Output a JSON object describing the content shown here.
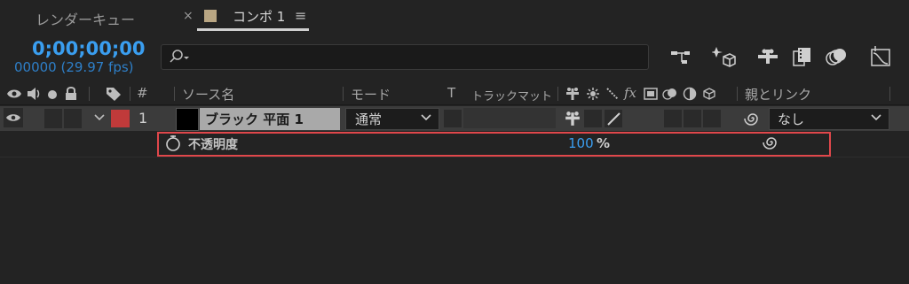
{
  "tabs": {
    "render_queue": "レンダーキュー",
    "close_symbol": "×",
    "comp": "コンポ 1",
    "menu_symbol": "≡"
  },
  "timecode": {
    "time": "0;00;00;00",
    "frames": "00000 (29.97 fps)"
  },
  "search": {
    "placeholder": ""
  },
  "toolbar": {
    "icons": [
      "flowchart-icon",
      "draft-3d-icon",
      "shy-layers-icon",
      "frame-blending-icon",
      "motion-blur-icon",
      "graph-editor-icon"
    ]
  },
  "header": {
    "index_symbol": "#",
    "source_name": "ソース名",
    "mode": "モード",
    "t": "T",
    "track_matte": "トラックマット",
    "fx": "fx",
    "parent_link": "親とリンク"
  },
  "layer": {
    "number": "1",
    "label_color": "#c03a3a",
    "name": "ブラック 平面 1",
    "mode": "通常",
    "parent": "なし"
  },
  "property": {
    "name": "不透明度",
    "value": "100",
    "unit": "%"
  },
  "colors": {
    "accent": "#3a9ef0",
    "highlight": "#e0474b"
  }
}
